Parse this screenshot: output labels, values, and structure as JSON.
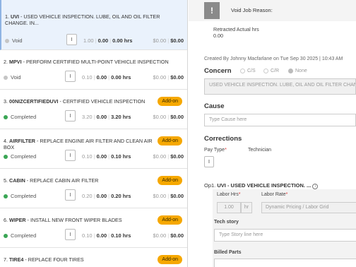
{
  "jobs": [
    {
      "num": "1.",
      "code": "UVI",
      "desc": " - USED VEHICLE INSPECTION. LUBE, OIL AND OIL FILTER CHANGE. IN...",
      "status": "Void",
      "pay": "I",
      "qty": "1.00",
      "hrs1": "0.00",
      "hrs2": "0.00 hrs",
      "amt1": "$0.00",
      "amt2": "$0.00",
      "addon": ""
    },
    {
      "num": "2.",
      "code": "MPVI",
      "desc": " - PERFORM CERTIFIED MULTI-POINT VEHICLE INSPECTION",
      "status": "Void",
      "pay": "I",
      "qty": "0.10",
      "hrs1": "0.00",
      "hrs2": "0.00 hrs",
      "amt1": "$0.00",
      "amt2": "$0.00",
      "addon": ""
    },
    {
      "num": "3.",
      "code": "00NIZCERTIFIEDUVI",
      "desc": " - CERTIFIED VEHICLE INSPECTION",
      "status": "Completed",
      "pay": "I",
      "qty": "3.20",
      "hrs1": "0.00",
      "hrs2": "3.20 hrs",
      "amt1": "$0.00",
      "amt2": "$0.00",
      "addon": "Add-on"
    },
    {
      "num": "4.",
      "code": "AIRFILTER",
      "desc": " - REPLACE ENGINE AIR FILTER AND CLEAN AIR BOX",
      "status": "Completed",
      "pay": "I",
      "qty": "0.10",
      "hrs1": "0.00",
      "hrs2": "0.10 hrs",
      "amt1": "$0.00",
      "amt2": "$0.00",
      "addon": "Add-on"
    },
    {
      "num": "5.",
      "code": "CABIN",
      "desc": " - REPLACE CABIN AIR FILTER",
      "status": "Completed",
      "pay": "I",
      "qty": "0.20",
      "hrs1": "0.00",
      "hrs2": "0.20 hrs",
      "amt1": "$0.00",
      "amt2": "$0.00",
      "addon": "Add-on"
    },
    {
      "num": "6.",
      "code": "WIPER",
      "desc": " - INSTALL NEW FRONT WIPER BLADES",
      "status": "Completed",
      "pay": "I",
      "qty": "0.10",
      "hrs1": "0.00",
      "hrs2": "0.10 hrs",
      "amt1": "$0.00",
      "amt2": "$0.00",
      "addon": "Add-on"
    },
    {
      "num": "7.",
      "code": "TIRE4",
      "desc": " - REPLACE FOUR TIRES",
      "status": "",
      "pay": "",
      "qty": "",
      "hrs1": "",
      "hrs2": "",
      "amt1": "",
      "amt2": "",
      "addon": "Add-on"
    }
  ],
  "right": {
    "void_icon": "!",
    "void_reason_label": "Void Job Reason:",
    "retracted_label": "Retracted Actual hrs",
    "retracted_value": "0.00",
    "created_by": "Created By Johnny Macfarlane on Tue Sep 30 2025 | 10:43 AM",
    "concern_heading": "Concern",
    "concern_options": [
      "C/S",
      "C/R",
      "None"
    ],
    "concern_text": "USED VEHICLE INSPECTION. LUBE, OIL AND OIL FILTER CHANGE",
    "cause_heading": "Cause",
    "cause_placeholder": "Type Cause here",
    "corrections_heading": "Corrections",
    "pay_type_label": "Pay Type",
    "pay_type_value": "I",
    "technician_label": "Technician",
    "op_number": "Op1.",
    "op_title": "UVI - USED VEHICLE INSPECTION. ...",
    "labor_hrs_label": "Labor Hrs",
    "labor_hrs_value": "1.00",
    "labor_hrs_unit": "hr",
    "labor_rate_label": "Labor Rate",
    "labor_rate_value": "Dynamic Pricing / Labor Grid",
    "tech_story_label": "Tech story",
    "tech_story_placeholder": "Type Story line here",
    "billed_parts_label": "Billed Parts",
    "required_mark": "*",
    "info_icon": "i"
  }
}
